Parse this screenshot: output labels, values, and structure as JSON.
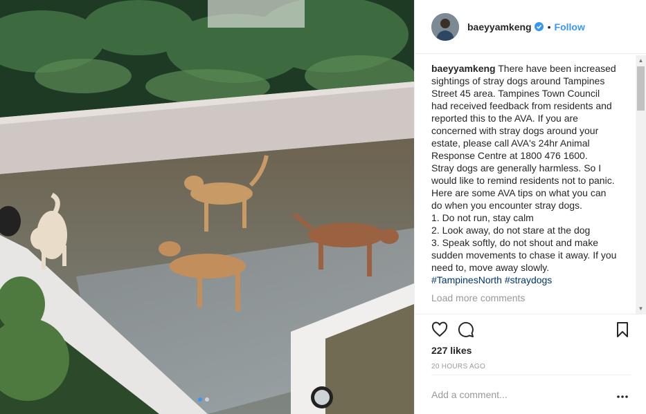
{
  "post": {
    "username": "baeyyamkeng",
    "verified": true,
    "separator": "•",
    "follow_label": "Follow",
    "caption_user": "baeyyamkeng",
    "caption": "There have been increased sightings of stray dogs around Tampines Street 45 area. Tampines Town Council had received feedback from residents and reported this to the AVA. If you are concerned with stray dogs around your estate, please call AVA's 24hr Animal Response Centre at 1800 476 1600.\nStray dogs are generally harmless. So I would like to remind residents not to panic. Here are some AVA tips on what you can do when you encounter stray dogs.\n1. Do not run, stay calm\n2. Look away, do not stare at the dog\n3. Speak softly, do not shout and make sudden movements to chase it away. If you need to, move away slowly.",
    "hashtag_1": "#TampinesNorth",
    "hashtag_2": "#straydogs",
    "load_more_label": "Load more comments",
    "likes": "227 likes",
    "timestamp": "20 HOURS AGO",
    "comment_placeholder": "Add a comment...",
    "carousel": {
      "count": 2,
      "active": 1
    }
  },
  "icons": {
    "like": "heart-icon",
    "comment": "comment-bubble-icon",
    "save": "bookmark-icon",
    "more": "more-options-icon",
    "verified": "verified-badge-icon"
  },
  "colors": {
    "accent": "#3897f0",
    "text": "#262626",
    "muted": "#999999",
    "hashtag": "#003569",
    "border": "#efefef"
  }
}
